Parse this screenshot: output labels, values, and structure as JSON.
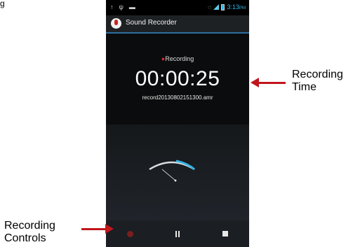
{
  "page": {
    "top_fragment": "g"
  },
  "status_bar": {
    "time": "3:13",
    "ampm": "PM"
  },
  "app": {
    "title": "Sound Recorder",
    "icon": "microphone-icon"
  },
  "recorder": {
    "state_label": "Recording",
    "elapsed_time": "00:00:25",
    "filename": "record20130802151300.amr"
  },
  "controls": {
    "record_icon": "record-icon",
    "pause_icon": "pause-icon",
    "stop_icon": "stop-icon"
  },
  "annotations": {
    "recording_time_line1": "Recording",
    "recording_time_line2": "Time",
    "recording_controls_line1": "Recording",
    "recording_controls_line2": "Controls"
  },
  "colors": {
    "accent_blue": "#33b5e5",
    "recording_red": "#d32b2b",
    "annotation_arrow": "#c0161c"
  }
}
